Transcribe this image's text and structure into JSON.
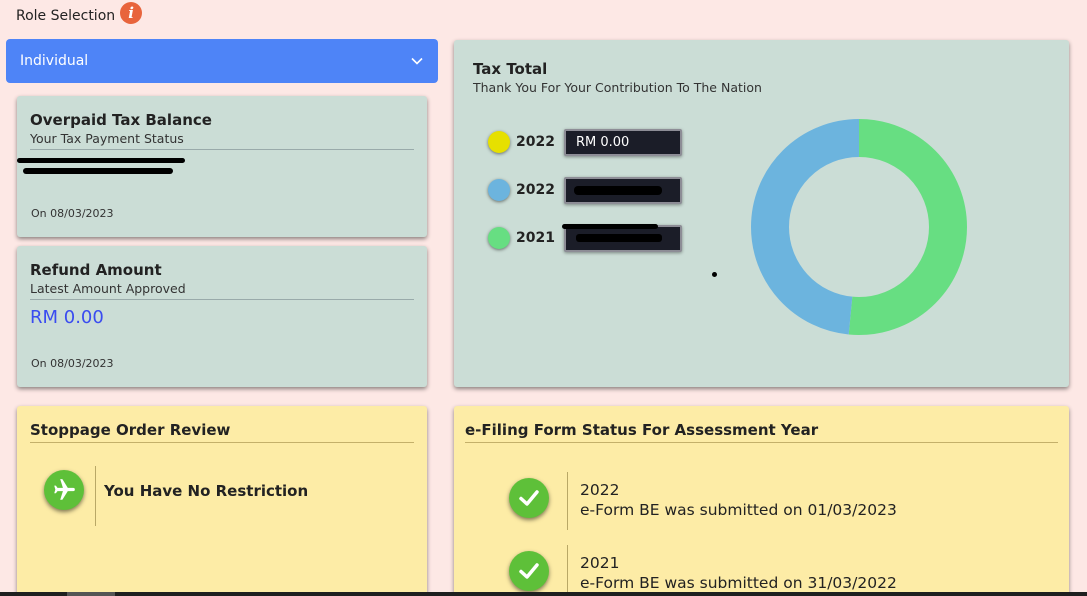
{
  "role_selection": {
    "label": "Role Selection",
    "info_icon": "info-icon",
    "selected": "Individual"
  },
  "overpaid": {
    "title": "Overpaid Tax Balance",
    "subtitle": "Your Tax Payment Status",
    "date": "On 08/03/2023"
  },
  "refund": {
    "title": "Refund Amount",
    "subtitle": "Latest Amount Approved",
    "amount": "RM 0.00",
    "date": "On 08/03/2023"
  },
  "tax_total": {
    "title": "Tax Total",
    "subtitle": "Thank You For Your Contribution To The Nation",
    "legend": [
      {
        "year": "2022",
        "value": "RM 0.00",
        "color": "#e6e000"
      },
      {
        "year": "2022",
        "value": "",
        "color": "#6cb4de"
      },
      {
        "year": "2021",
        "value": "",
        "color": "#67de82"
      }
    ]
  },
  "chart_data": {
    "type": "pie",
    "donut": true,
    "series": [
      {
        "color": "#e6e000",
        "value": 0
      },
      {
        "color": "#6cb4de",
        "value": 48.5
      },
      {
        "color": "#67de82",
        "value": 51.5
      }
    ]
  },
  "stoppage": {
    "title": "Stoppage Order Review",
    "message": "You Have No Restriction",
    "icon": "airplane-icon"
  },
  "efiling": {
    "title": "e-Filing Form Status For Assessment Year",
    "items": [
      {
        "year": "2022",
        "status": "e-Form BE was submitted on 01/03/2023"
      },
      {
        "year": "2021",
        "status": "e-Form BE was submitted on 31/03/2022"
      }
    ]
  },
  "colors": {
    "background": "#fde8e5",
    "select": "#4e84f7",
    "card_green": "#cbddd6",
    "card_yellow": "#fdeca6",
    "amount": "#3a4cf0",
    "success": "#5ec039"
  }
}
